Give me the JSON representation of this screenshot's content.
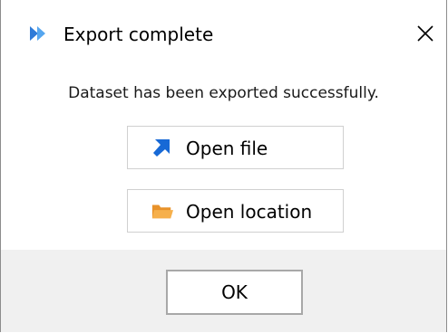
{
  "window": {
    "title": "Export complete",
    "app_icon": "app-logo-icon",
    "close_icon": "close-icon"
  },
  "message": "Dataset has been exported successfully.",
  "actions": [
    {
      "label": "Open file",
      "icon": "arrow-up-right-icon",
      "icon_color": "#1769d6"
    },
    {
      "label": "Open location",
      "icon": "folder-icon",
      "icon_color": "#f2a33a"
    }
  ],
  "footer": {
    "ok_label": "OK"
  },
  "colors": {
    "accent": "#2f7bd8",
    "footer_bg": "#f0f0f0"
  }
}
